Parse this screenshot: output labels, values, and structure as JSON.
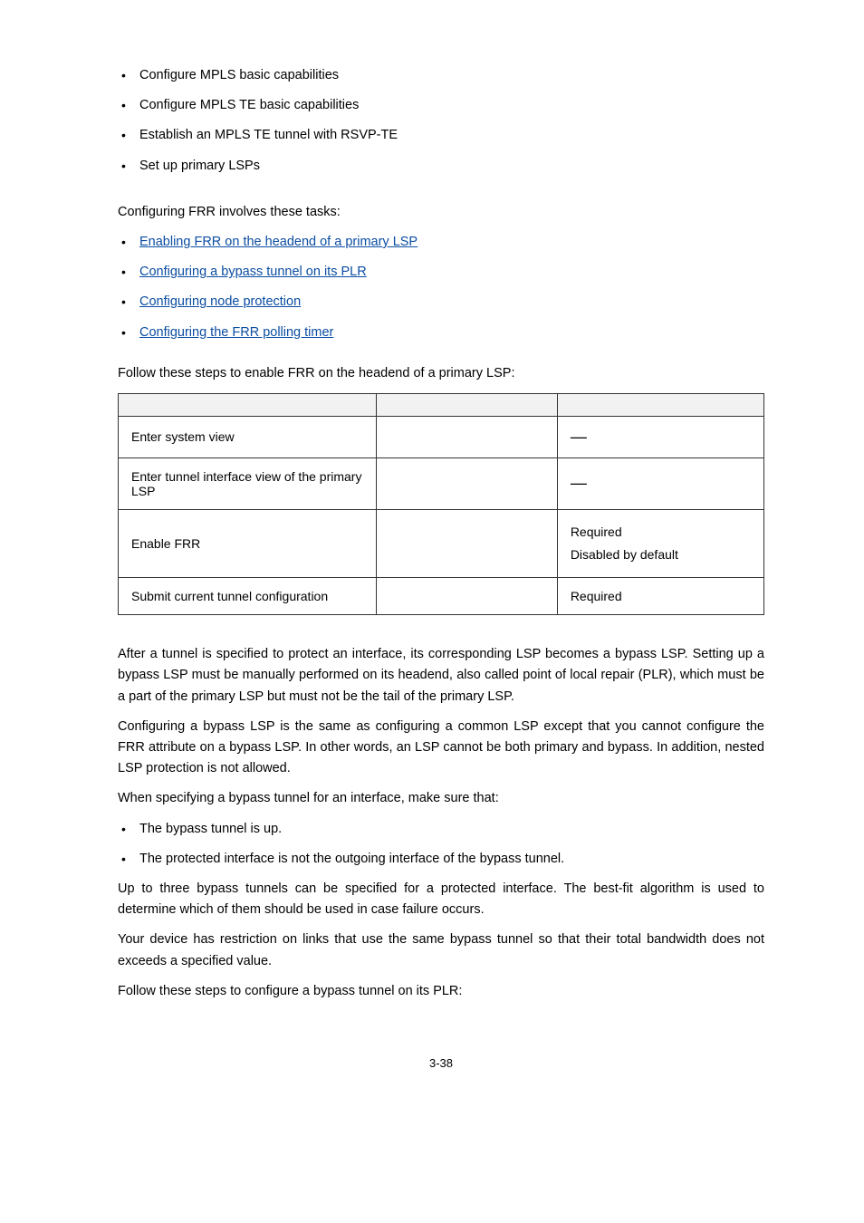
{
  "top_bullets": [
    "Configure MPLS basic capabilities",
    "Configure MPLS TE basic capabilities",
    "Establish an MPLS TE tunnel with RSVP-TE",
    "Set up primary LSPs"
  ],
  "tasks_intro": "Configuring FRR involves these tasks:",
  "task_links": [
    "Enabling FRR on the headend of a primary LSP",
    "Configuring a bypass tunnel on its PLR",
    "Configuring node protection",
    "Configuring the FRR polling timer"
  ],
  "steps_intro": "Follow these steps to enable FRR on the headend of a primary LSP:",
  "table": {
    "headers": [
      "",
      "",
      ""
    ],
    "rows": [
      {
        "todo": "Enter system view",
        "cmd": "",
        "remarks": "—"
      },
      {
        "todo": "Enter tunnel interface view of the primary LSP",
        "cmd": "",
        "remarks": "—"
      },
      {
        "todo": "Enable FRR",
        "cmd": "",
        "remarks_lines": [
          "Required",
          "Disabled by default"
        ]
      },
      {
        "todo": "Submit current tunnel configuration",
        "cmd": "",
        "remarks": "Required"
      }
    ]
  },
  "body_paras": [
    "After a tunnel is specified to protect an interface, its corresponding LSP becomes a bypass LSP. Setting up a bypass LSP must be manually performed on its headend, also called point of local repair (PLR), which must be a part of the primary LSP but must not be the tail of the primary LSP.",
    "Configuring a bypass LSP is the same as configuring a common LSP except that you cannot configure the FRR attribute on a bypass LSP. In other words, an LSP cannot be both primary and bypass. In addition, nested LSP protection is not allowed.",
    "When specifying a bypass tunnel for an interface, make sure that:"
  ],
  "inner_bullets": [
    "The bypass tunnel is up.",
    "The protected interface is not the outgoing interface of the bypass tunnel."
  ],
  "tail_paras": [
    "Up to three bypass tunnels can be specified for a protected interface. The best-fit algorithm is used to determine which of them should be used in case failure occurs.",
    "Your device has restriction on links that use the same bypass tunnel so that their total bandwidth does not exceeds a specified value.",
    "Follow these steps to configure a bypass tunnel on its PLR:"
  ],
  "page_number": "3-38"
}
